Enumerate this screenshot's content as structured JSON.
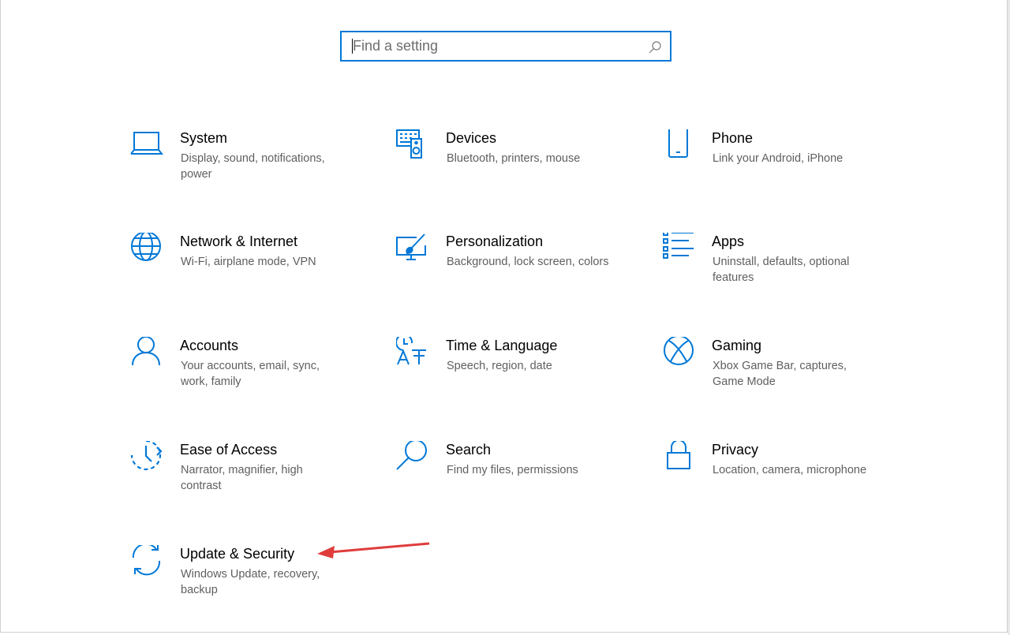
{
  "search": {
    "placeholder": "Find a setting"
  },
  "tiles": [
    {
      "title": "System",
      "desc": "Display, sound, notifications, power",
      "icon": "laptop-icon"
    },
    {
      "title": "Devices",
      "desc": "Bluetooth, printers, mouse",
      "icon": "keyboard-speaker-icon"
    },
    {
      "title": "Phone",
      "desc": "Link your Android, iPhone",
      "icon": "phone-icon"
    },
    {
      "title": "Network & Internet",
      "desc": "Wi-Fi, airplane mode, VPN",
      "icon": "globe-icon"
    },
    {
      "title": "Personalization",
      "desc": "Background, lock screen, colors",
      "icon": "paint-brush-icon"
    },
    {
      "title": "Apps",
      "desc": "Uninstall, defaults, optional features",
      "icon": "apps-list-icon"
    },
    {
      "title": "Accounts",
      "desc": "Your accounts, email, sync, work, family",
      "icon": "person-icon"
    },
    {
      "title": "Time & Language",
      "desc": "Speech, region, date",
      "icon": "time-language-icon"
    },
    {
      "title": "Gaming",
      "desc": "Xbox Game Bar, captures, Game Mode",
      "icon": "xbox-icon"
    },
    {
      "title": "Ease of Access",
      "desc": "Narrator, magnifier, high contrast",
      "icon": "ease-of-access-icon"
    },
    {
      "title": "Search",
      "desc": "Find my files, permissions",
      "icon": "magnifier-icon"
    },
    {
      "title": "Privacy",
      "desc": "Location, camera, microphone",
      "icon": "lock-icon"
    },
    {
      "title": "Update & Security",
      "desc": "Windows Update, recovery, backup",
      "icon": "sync-arrows-icon"
    }
  ],
  "colors": {
    "accent": "#0078d7",
    "annotation_arrow": "#e03c3c",
    "description": "#5f5f5f"
  }
}
